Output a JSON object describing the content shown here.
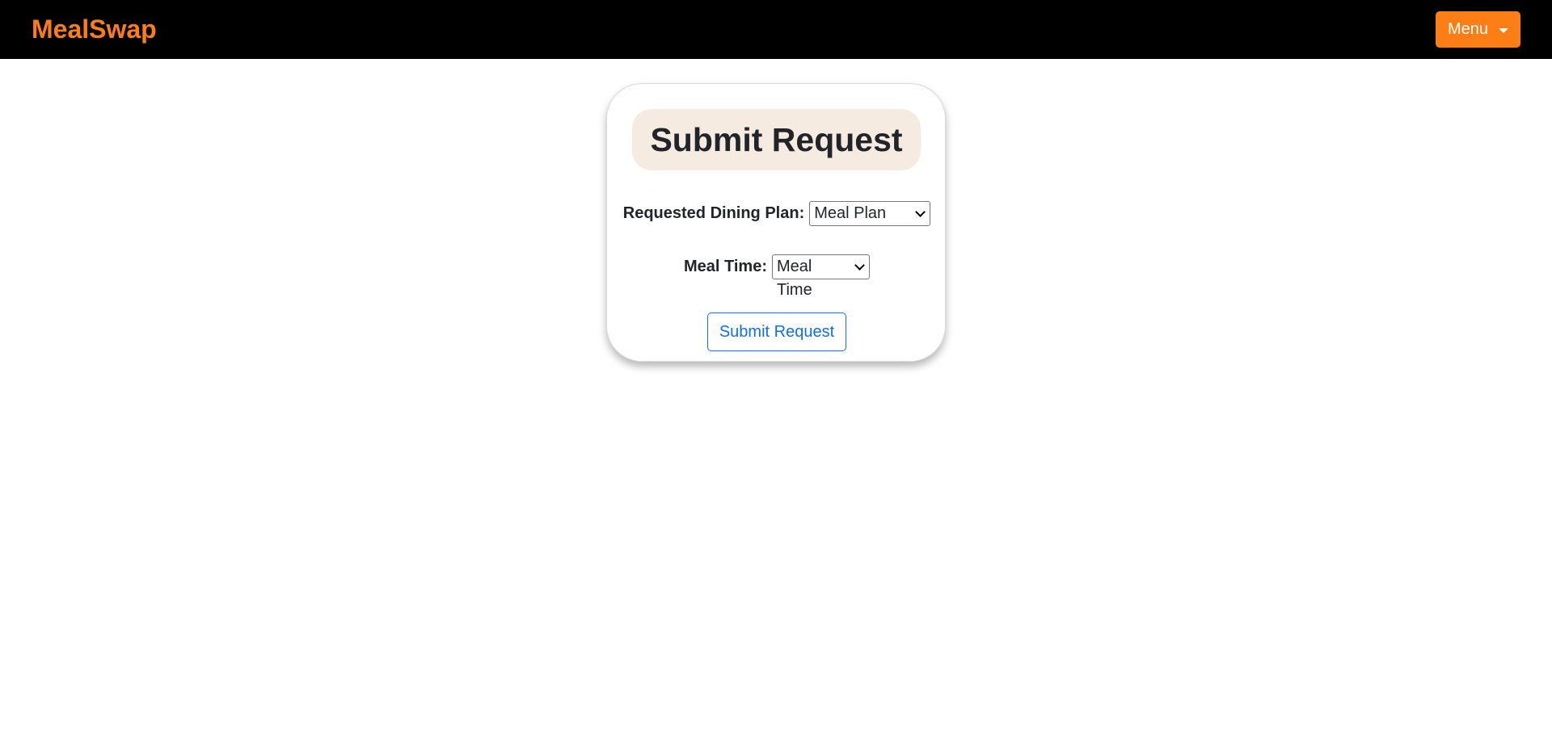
{
  "header": {
    "brand": "MealSwap",
    "menu_label": "Menu"
  },
  "form": {
    "title": "Submit Request",
    "dining_plan_label": "Requested Dining Plan:",
    "dining_plan_selected": "Meal Plan",
    "meal_time_label": "Meal Time:",
    "meal_time_selected": "Meal Time",
    "submit_label": "Submit Request"
  },
  "colors": {
    "brand": "#fd7e14",
    "navbar_bg": "#000000",
    "title_pill_bg": "#f5ebe0",
    "submit_accent": "#0d6efd"
  },
  "icons": {
    "menu_caret": "caret-down-icon",
    "select_chevron": "chevron-down-icon"
  }
}
